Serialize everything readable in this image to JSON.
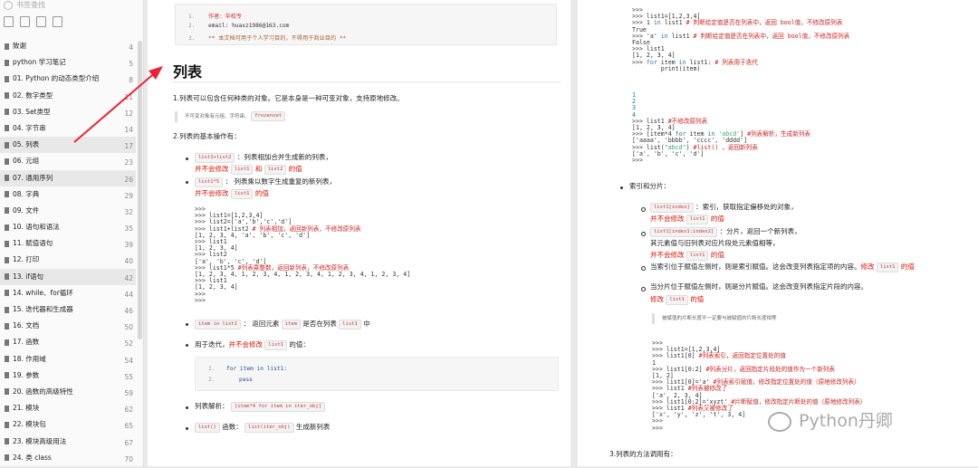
{
  "sidebar": {
    "search_placeholder": "书签查找",
    "toc": [
      {
        "label": "致谢",
        "page": "4"
      },
      {
        "label": "python 学习笔记",
        "page": "5"
      },
      {
        "label": "01. Python 的动态类型介绍",
        "page": "8"
      },
      {
        "label": "02. 数字类型",
        "page": "11"
      },
      {
        "label": "03. Set类型",
        "page": "12"
      },
      {
        "label": "04. 字节串",
        "page": "14"
      },
      {
        "label": "05. 列表",
        "page": "17"
      },
      {
        "label": "06. 元组",
        "page": "23"
      },
      {
        "label": "07. 通用序列",
        "page": "26"
      },
      {
        "label": "08. 字典",
        "page": "29"
      },
      {
        "label": "09. 文件",
        "page": "32"
      },
      {
        "label": "10. 语句和语法",
        "page": "35"
      },
      {
        "label": "11. 赋值语句",
        "page": "39"
      },
      {
        "label": "12. 打印",
        "page": "40"
      },
      {
        "label": "13. if语句",
        "page": "42"
      },
      {
        "label": "14. while、for循环",
        "page": "44"
      },
      {
        "label": "15. 迭代器和生成器",
        "page": "46"
      },
      {
        "label": "16. 文档",
        "page": "50"
      },
      {
        "label": "17. 函数",
        "page": "52"
      },
      {
        "label": "18. 作用域",
        "page": "54"
      },
      {
        "label": "19. 参数",
        "page": "55"
      },
      {
        "label": "20. 函数的高级特性",
        "page": "59"
      },
      {
        "label": "21. 模块",
        "page": "62"
      },
      {
        "label": "22. 模块包",
        "page": "65"
      },
      {
        "label": "23. 模块高级用法",
        "page": "67"
      },
      {
        "label": "24. 类 class",
        "page": "70"
      }
    ]
  },
  "page1": {
    "header": {
      "line1_num": "1.",
      "line1": "作者：华校专",
      "line2_num": "2.",
      "line2": "email: huaxz1986@163.com",
      "line3_num": "3.",
      "line3": "**  本文档可用于个人学习目的，不得用于商业目的  **"
    },
    "title": "列表",
    "p1": "1.列表可以包含任何种类的对象。它是本身是一种可变对象，支持原地修改。",
    "quote1_text": "不可变对象有元组、字符串、",
    "quote1_chip": "frozenset",
    "p2": "2.列表的基本操作有：",
    "b1_chip": "list1+list2",
    "b1_text": "：列表相加合并生成新的列表，",
    "b1_red1": "并不会修改",
    "b1_chip2": "list1",
    "b1_and": "和",
    "b1_chip3": "list2",
    "b1_red2": "的值",
    "b2_chip": "list1*5",
    "b2_text": "：   列表乘以数字生成重复的新列表，",
    "b2_red1": "并不会修改",
    "b2_chip2": "list1",
    "b2_red2": "的值",
    "b3_chip": "item in list1",
    "b3_text1": "：   返回元素",
    "b3_chip2": "item",
    "b3_text2": "是否在列表",
    "b3_chip3": "list1",
    "b3_text3": "中",
    "b4_text1": "用于迭代，",
    "b4_red1": "并不会修改",
    "b4_chip": "list1",
    "b4_text2": "的值：",
    "for_l1_num": "1.",
    "for_l1": "for item in list1:",
    "for_l2_num": "2.",
    "for_l2": "pass",
    "b5_text": "列表解析：",
    "b5_chip": "[item*4 for item in iter_obj]",
    "b6_chip": "list()",
    "b6_text1": "函数：",
    "b6_chip2": "list(iter_obj)",
    "b6_text2": "生成新列表"
  },
  "page2": {
    "bullet_title": "索引和分片：",
    "i1_chip": "list1[index]",
    "i1_text": "：索引，获取指定偏移处的对象，",
    "i1_red1": "并不会修改",
    "i1_chip2": "list1",
    "i1_red2": "的值",
    "i2_chip": "list1[index1:index2]",
    "i2_text": "：分片，返回一个新列表，",
    "i2_text2": "其元素值与旧列表对应片段处元素值相等，",
    "i2_red1": "并不会修改",
    "i2_chip2": "list1",
    "i2_red2": "的值",
    "i3_text": "当索引位于赋值左侧时，则是索引赋值。这会改变列表指定项的内容。",
    "i3_red": "修改",
    "i3_chip": "list1",
    "i3_red2": "的值",
    "i4_text": "当分片位于赋值左侧时，则是分片赋值。这会改变列表指定片段的内容。",
    "i4_red": "修改",
    "i4_chip": "list1",
    "i4_red2": "的值",
    "quote2": "被赋值的片断长度不一定要与被赋值的片断长度相等",
    "p3": "3.列表的方法调用有："
  },
  "watermark": "Python丹卿"
}
